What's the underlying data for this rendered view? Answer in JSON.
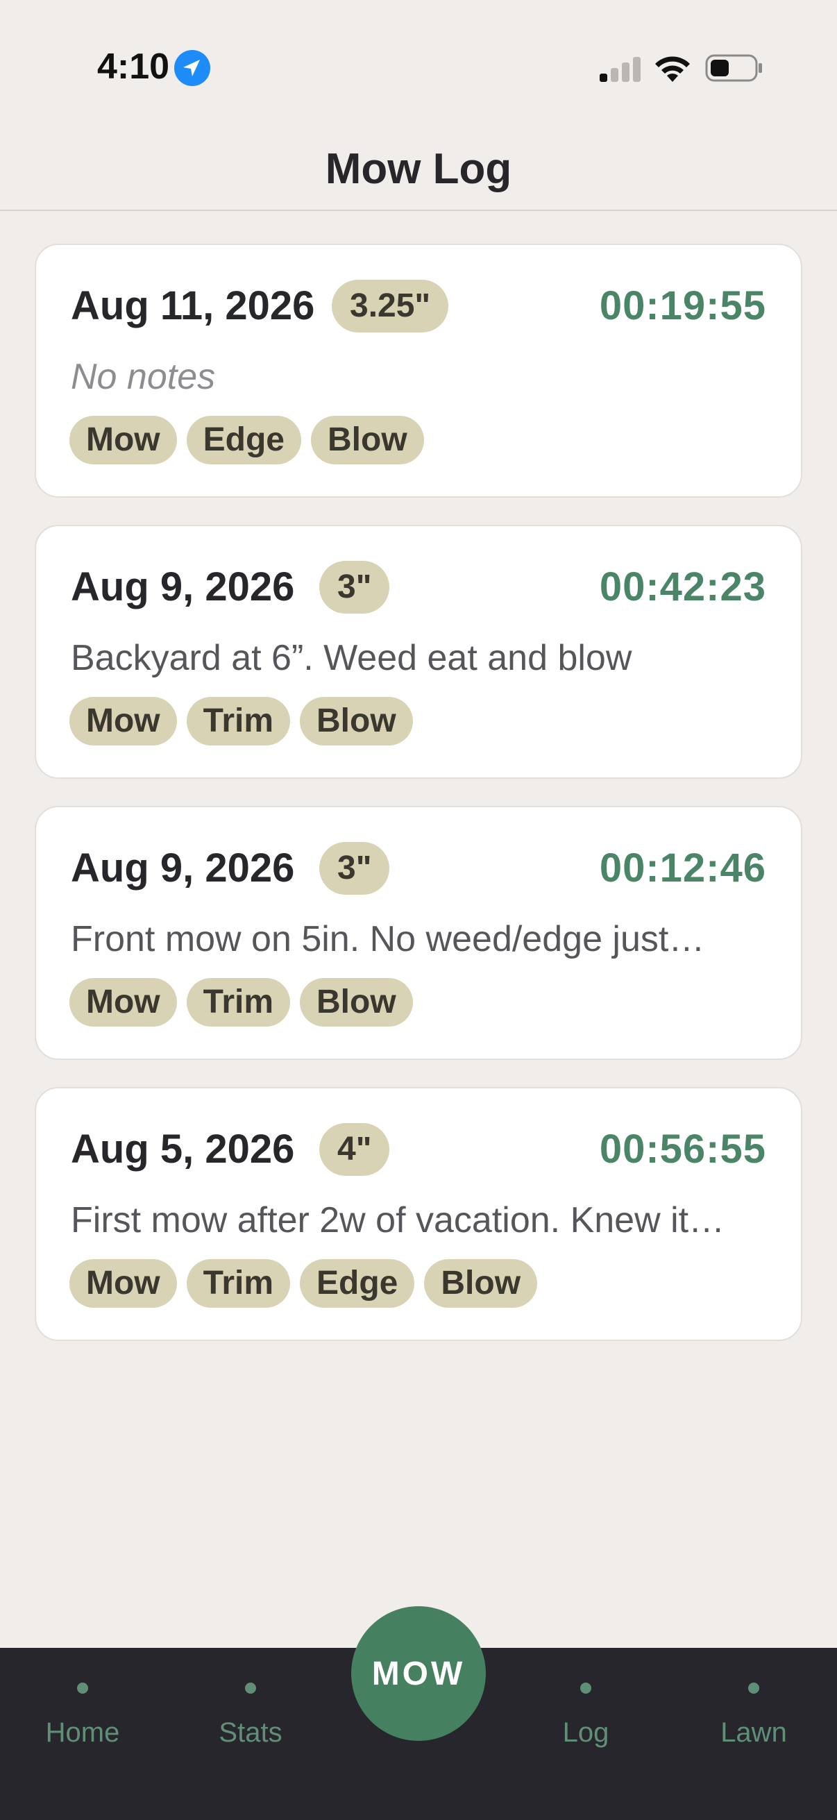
{
  "status_bar": {
    "time": "4:10",
    "icons": [
      "location-arrow-icon",
      "cellular-signal-icon",
      "wifi-icon",
      "battery-icon"
    ]
  },
  "header": {
    "title": "Mow Log"
  },
  "entries": [
    {
      "date": "Aug 11, 2026",
      "height": "3.25\"",
      "duration": "00:19:55",
      "note": "No notes",
      "note_empty": true,
      "tags": [
        "Mow",
        "Edge",
        "Blow"
      ]
    },
    {
      "date": "Aug 9, 2026",
      "height": "3\"",
      "duration": "00:42:23",
      "note": "Backyard at 6”. Weed eat and blow",
      "note_empty": false,
      "tags": [
        "Mow",
        "Trim",
        "Blow"
      ]
    },
    {
      "date": "Aug 9, 2026",
      "height": "3\"",
      "duration": "00:12:46",
      "note": "Front mow on 5in. No weed/edge just…",
      "note_empty": false,
      "tags": [
        "Mow",
        "Trim",
        "Blow"
      ]
    },
    {
      "date": "Aug 5, 2026",
      "height": "4\"",
      "duration": "00:56:55",
      "note": "First mow after 2w of vacation. Knew it…",
      "note_empty": false,
      "tags": [
        "Mow",
        "Trim",
        "Edge",
        "Blow"
      ]
    }
  ],
  "tab_bar": {
    "tabs": [
      {
        "label": "Home"
      },
      {
        "label": "Stats"
      },
      {
        "label": "Log"
      },
      {
        "label": "Lawn"
      }
    ],
    "center_button": "MOW"
  },
  "colors": {
    "accent": "#458060",
    "duration": "#4b8567",
    "pill": "#d8d3b5",
    "background": "#f1edea",
    "tab_bar": "#28262d"
  }
}
